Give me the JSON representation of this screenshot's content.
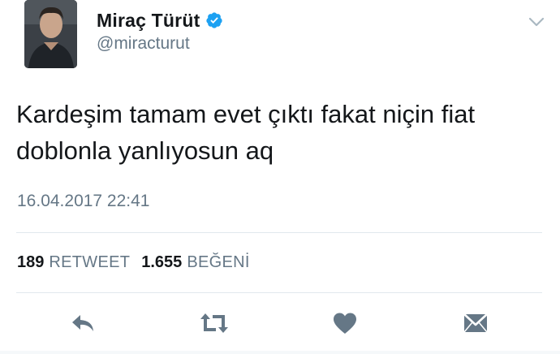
{
  "author": {
    "display_name": "Miraç Türüt",
    "handle": "@miracturut",
    "verified": true
  },
  "tweet": {
    "text_line1": "Kardeşim tamam evet çıktı fakat niçin fiat",
    "text_line2": "doblonla yanlıyosun aq",
    "timestamp": "16.04.2017 22:41"
  },
  "stats": {
    "retweet_count": "189",
    "retweet_label": "RETWEET",
    "like_count": "1.655",
    "like_label": "BEĞENİ"
  },
  "icons": {
    "verified": "verified-badge-icon",
    "menu": "chevron-down-icon",
    "reply": "reply-icon",
    "retweet": "retweet-icon",
    "like": "heart-icon",
    "dm": "envelope-icon"
  },
  "colors": {
    "verified_blue": "#1da1f2",
    "text_primary": "#14171a",
    "text_secondary": "#657786",
    "action_icon": "#657786",
    "divider": "#e1e8ed"
  }
}
